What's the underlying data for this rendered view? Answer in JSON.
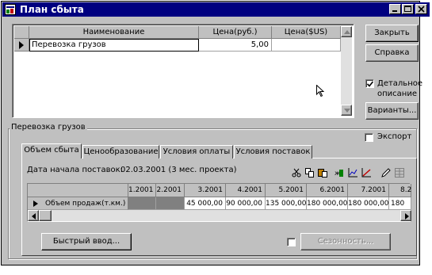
{
  "window": {
    "title": "План сбыта"
  },
  "top_grid": {
    "columns": [
      "Наименование",
      "Цена(руб.)",
      "Цена($US)"
    ],
    "rows": [
      {
        "name": "Перевозка грузов",
        "price_rub": "5,00",
        "price_usd": ""
      }
    ]
  },
  "buttons": {
    "close": "Закрыть",
    "help": "Справка",
    "variants": "Варианты..."
  },
  "detail_desc": {
    "label_line1": "Детальное",
    "label_line2": "описание",
    "checked": true
  },
  "group": {
    "title": "Перевозка грузов"
  },
  "export": {
    "label": "Экспорт",
    "checked": false
  },
  "tabs": [
    "Объем сбыта",
    "Ценообразование",
    "Условия оплаты",
    "Условия поставок"
  ],
  "start_date": {
    "label": "Дата начала поставок:",
    "value": "02.03.2001 (3 мес. проекта)"
  },
  "sales_grid": {
    "periods": [
      "1.2001",
      "2.2001",
      "3.2001",
      "4.2001",
      "5.2001",
      "6.2001",
      "7.2001",
      "8.2"
    ],
    "row_label": "Объем продаж(т.км.)",
    "values": [
      "",
      "",
      "45 000,00",
      "90 000,00",
      "135 000,00",
      "180 000,00",
      "180 000,00",
      "180"
    ]
  },
  "quick_input": "Быстрый ввод...",
  "seasonality": {
    "label": "Сезонность...",
    "checked": false
  },
  "toolbar_icons": [
    "scissors-icon",
    "copy-icon",
    "paste-icon",
    "fill-series-icon",
    "chart-icon",
    "trend-icon",
    "pencil-icon",
    "table-icon"
  ]
}
